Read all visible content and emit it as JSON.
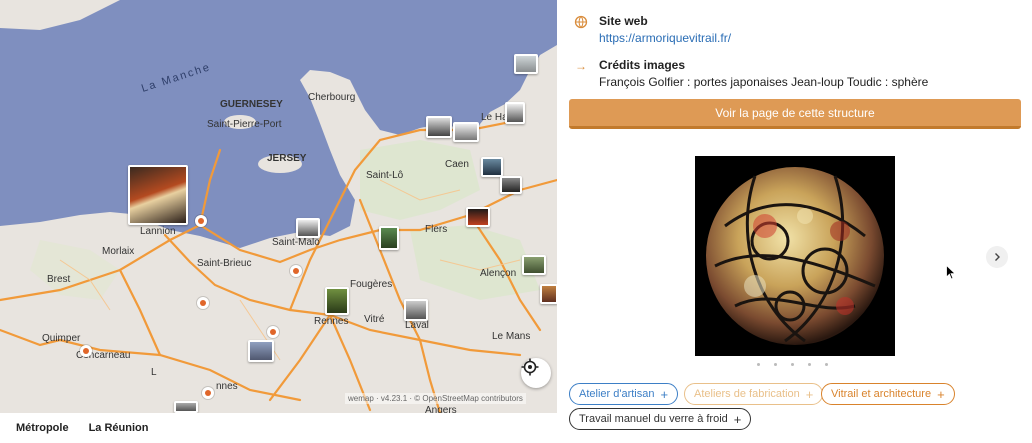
{
  "map": {
    "sea_label": "La Manche",
    "labels": {
      "guernesey": "GUERNESEY",
      "saint_pierre_port": "Saint-Pierre-Port",
      "jersey": "JERSEY",
      "cherbourg": "Cherbourg",
      "le_havre": "Le Ha",
      "caen": "Caen",
      "saint_lo": "Saint-Lô",
      "lannion": "Lannion",
      "morlaix": "Morlaix",
      "brest": "Brest",
      "saint_brieuc": "Saint-Brieuc",
      "saint_malo": "Saint-Malo",
      "flers": "Flers",
      "fougeres": "Fougères",
      "alencon": "Alençon",
      "rennes": "Rennes",
      "vitre": "Vitré",
      "laval": "Laval",
      "quimper": "Quimper",
      "concarneau": "Concarneau",
      "le_mans": "Le Mans",
      "vannes": "nnes",
      "angers": "Angers",
      "lorient": "L"
    },
    "attribution": "wemap · v4.23.1 · © OpenStreetMap contributors",
    "tabs": [
      "Métropole",
      "La Réunion"
    ]
  },
  "panel": {
    "website": {
      "title": "Site web",
      "url": "https://armoriquevitrail.fr/"
    },
    "credits": {
      "title": "Crédits images",
      "text": "François Golfier : portes japonaises Jean-loup Toudic : sphère"
    },
    "cta_label": "Voir la page de cette structure",
    "tags": [
      {
        "label": "Atelier d'artisan",
        "color": "#3d7fc6"
      },
      {
        "label": "Ateliers de fabrication",
        "color": "#e9c08a"
      },
      {
        "label": "Vitrail et architecture",
        "color": "#d9832c"
      },
      {
        "label": "Travail manuel du verre à froid",
        "color": "#333333"
      }
    ],
    "icons": {
      "website": "globe-icon",
      "credits": "arrow-right-icon",
      "next": "chevron-right-icon"
    }
  }
}
